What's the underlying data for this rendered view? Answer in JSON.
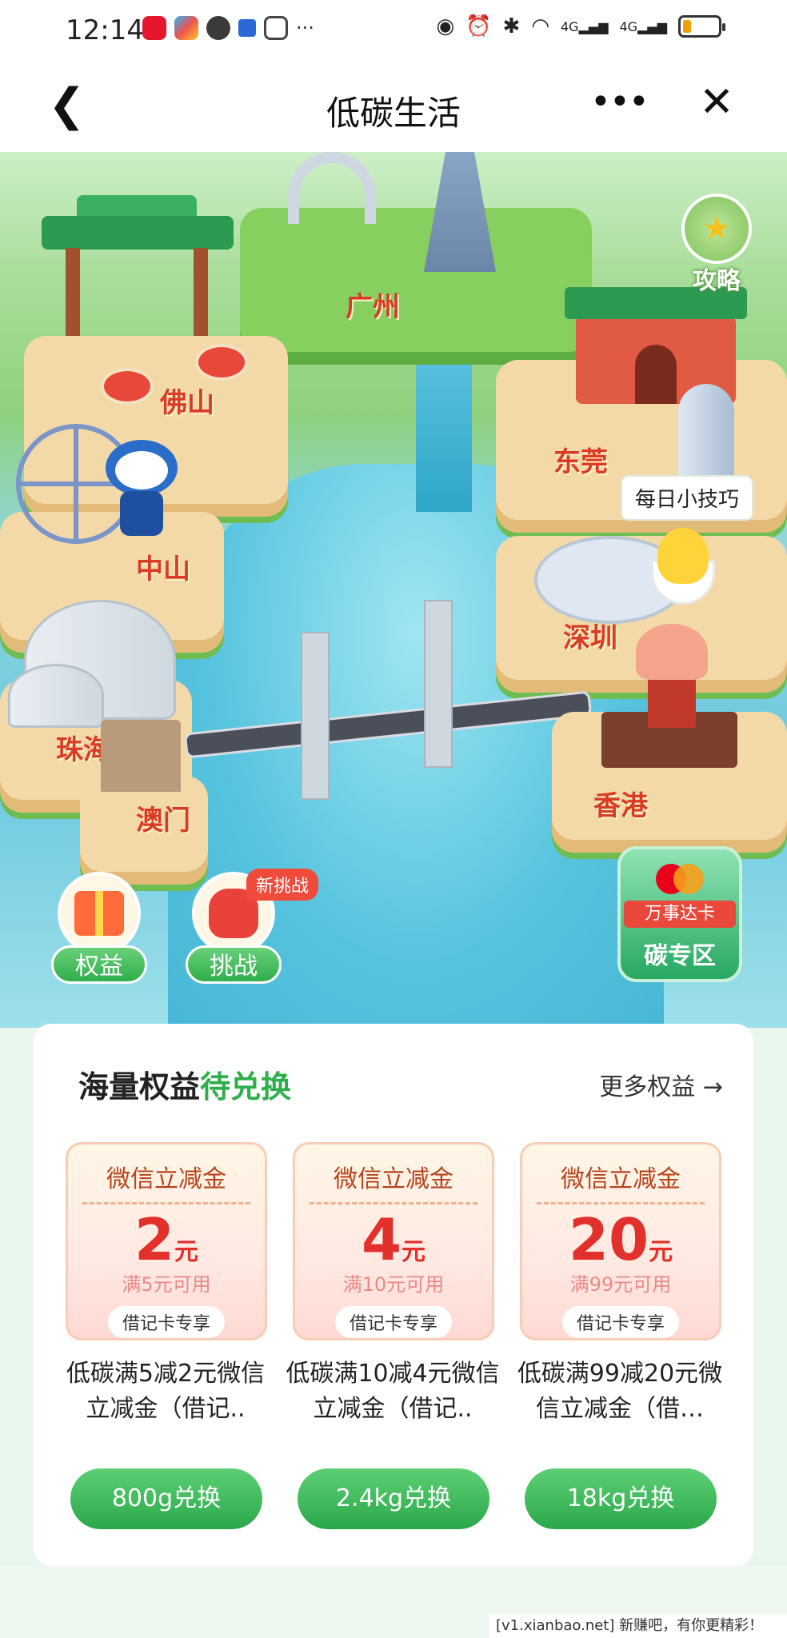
{
  "status_bar": {
    "time": "12:14",
    "signal_1": "4G",
    "signal_2": "4G",
    "more": "···"
  },
  "nav": {
    "title": "低碳生活",
    "back_icon": "chevron-left-icon",
    "more_icon": "more-icon",
    "close_icon": "close-icon"
  },
  "map": {
    "guide_label": "攻略",
    "daily_tip": "每日小技巧",
    "cities": {
      "guangzhou": "广州",
      "foshan": "佛山",
      "dongguan": "东莞",
      "zhongshan": "中山",
      "shenzhen": "深圳",
      "zhuhai": "珠海",
      "macau": "澳门",
      "hongkong": "香港"
    },
    "benefits_button": "权益",
    "challenge_button": "挑战",
    "challenge_badge": "新挑战",
    "mastercard": {
      "ribbon": "万事达卡",
      "title": "碳专区"
    }
  },
  "benefits": {
    "title_main": "海量权益",
    "title_highlight": "待兑换",
    "more_label": "更多权益 →",
    "coupons": [
      {
        "header": "微信立减金",
        "amount": "2",
        "unit": "元",
        "condition": "满5元可用",
        "tag": "借记卡专享",
        "desc": "低碳满5减2元微信立减金（借记..",
        "button": "800g兑换"
      },
      {
        "header": "微信立减金",
        "amount": "4",
        "unit": "元",
        "condition": "满10元可用",
        "tag": "借记卡专享",
        "desc": "低碳满10减4元微信立减金（借记..",
        "button": "2.4kg兑换"
      },
      {
        "header": "微信立减金",
        "amount": "20",
        "unit": "元",
        "condition": "满99元可用",
        "tag": "借记卡专享",
        "desc": "低碳满99减20元微信立减金（借…",
        "button": "18kg兑换"
      }
    ]
  },
  "watermark": "[v1.xianbao.net] 新赚吧，有你更精彩！",
  "colors": {
    "accent_green": "#2fae4b",
    "coupon_red": "#e2302c",
    "badge_red": "#ef4a3a"
  }
}
